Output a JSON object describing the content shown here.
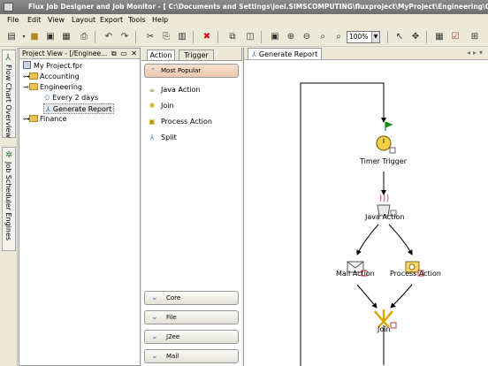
{
  "window": {
    "title": "Flux Job Designer and Job Monitor - [ C:\\Documents and Settings\\joel.SIMSCOMPUTING\\fluxproject\\MyProject\\Engineering\\Generate Report ]"
  },
  "menu": [
    "File",
    "Edit",
    "View",
    "Layout",
    "Export",
    "Tools",
    "Help"
  ],
  "toolbar": {
    "zoom": "100%"
  },
  "side_tabs": {
    "flow_chart_overview": "Flow Chart Overview",
    "job_scheduler_engines": "Job Scheduler Engines"
  },
  "project_panel": {
    "title": "Project View - [/Enginee...",
    "controls": "⧉ ▭ ✕",
    "tree": {
      "root": "My Project.fpr",
      "accounting": "Accounting",
      "engineering": "Engineering",
      "every_2_days": "Every 2 days",
      "generate_report": "Generate Report",
      "finance": "Finance"
    }
  },
  "palette": {
    "tabs": [
      "Action",
      "Trigger"
    ],
    "most_popular": "Most Popular",
    "items": [
      "Java Action",
      "Join",
      "Process Action",
      "Split"
    ],
    "drawers": [
      "Core",
      "File",
      "J2ee",
      "Mail"
    ]
  },
  "canvas": {
    "tab": "Generate Report",
    "nodes": {
      "timer_trigger": "Timer Trigger",
      "java_action": "Java Action",
      "mail_action": "Mail Action",
      "process_action": "Process Action",
      "join": "Join"
    }
  }
}
